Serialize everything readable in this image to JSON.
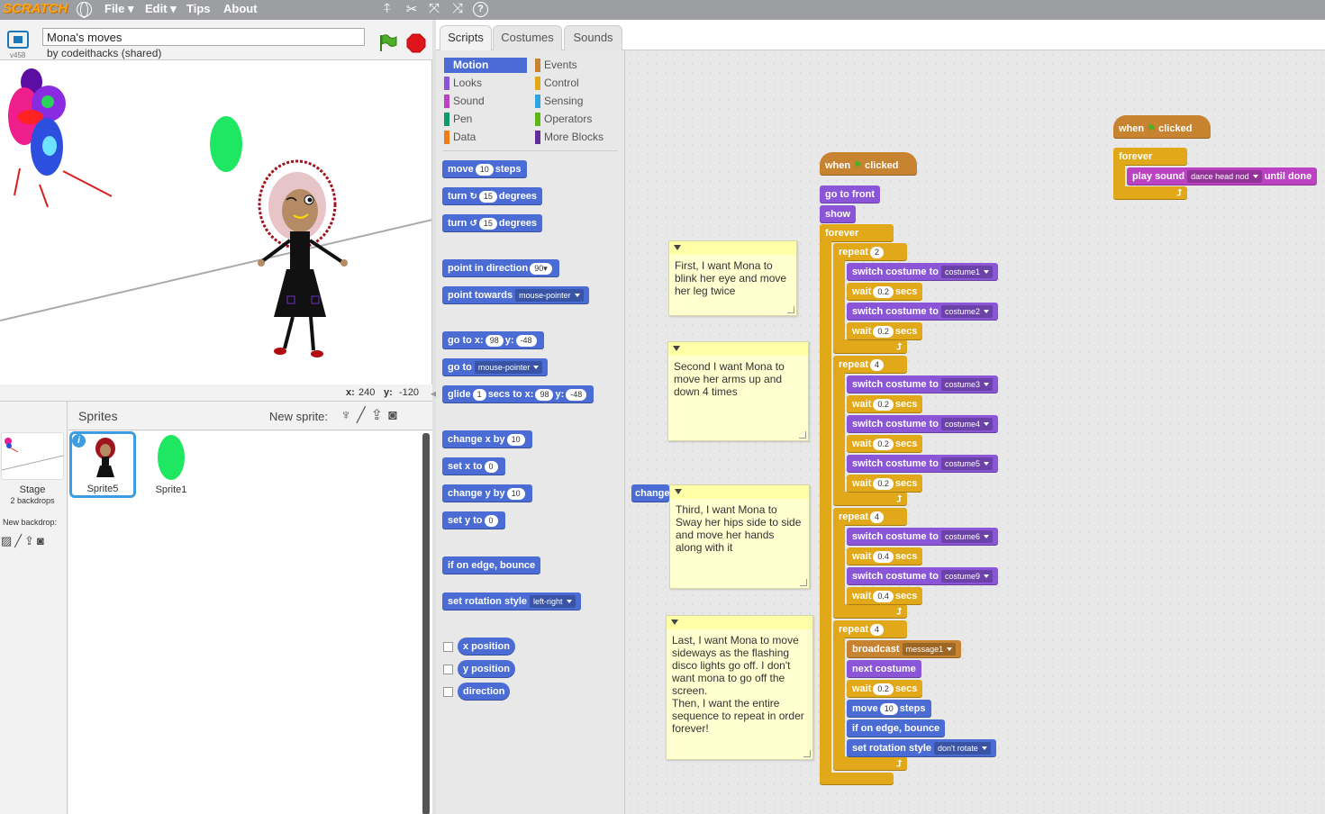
{
  "topbar": {
    "logo": "SCRATCH",
    "menus": [
      "File ▾",
      "Edit ▾",
      "Tips",
      "About"
    ],
    "tool_icons": [
      "duplicate-icon",
      "cut-icon",
      "grow-icon",
      "shrink-icon",
      "help-icon"
    ]
  },
  "stage_header": {
    "version": "v458",
    "project_title": "Mona's moves",
    "byline": "by codeithacks (shared)"
  },
  "stage": {
    "x_label": "x:",
    "x_value": "240",
    "y_label": "y:",
    "y_value": "-120"
  },
  "sprites_pane": {
    "header": "Sprites",
    "new_sprite_label": "New sprite:",
    "stage_label": "Stage",
    "stage_backdrops": "2 backdrops",
    "new_backdrop_label": "New backdrop:",
    "sprites": [
      {
        "name": "Sprite5",
        "selected": true
      },
      {
        "name": "Sprite1",
        "selected": false
      }
    ]
  },
  "tabs": [
    "Scripts",
    "Costumes",
    "Sounds"
  ],
  "categories": {
    "left": [
      {
        "label": "Motion",
        "color": "#4a6cd4"
      },
      {
        "label": "Looks",
        "color": "#8a55d7"
      },
      {
        "label": "Sound",
        "color": "#bb42c3"
      },
      {
        "label": "Pen",
        "color": "#0e9a6c"
      },
      {
        "label": "Data",
        "color": "#ee7d16"
      }
    ],
    "right": [
      {
        "label": "Events",
        "color": "#c88330"
      },
      {
        "label": "Control",
        "color": "#e1a91a"
      },
      {
        "label": "Sensing",
        "color": "#2ca5e2"
      },
      {
        "label": "Operators",
        "color": "#5cb712"
      },
      {
        "label": "More Blocks",
        "color": "#632d99"
      }
    ]
  },
  "palette": {
    "move": "move",
    "move_n": "10",
    "steps": "steps",
    "turn": "turn",
    "turn_n": "15",
    "degrees": "degrees",
    "point_in_direction": "point in direction",
    "dir_n": "90▾",
    "point_towards": "point towards",
    "mouse_pointer": "mouse-pointer",
    "go_to_x": "go to x:",
    "gx": "98",
    "y": "y:",
    "gy": "-48",
    "go_to": "go to",
    "glide": "glide",
    "glide_n": "1",
    "secs_to_x": "secs to x:",
    "change_x_by": "change x by",
    "cx": "10",
    "set_x_to": "set x to",
    "sx": "0",
    "change_y_by": "change y by",
    "cy": "10",
    "set_y_to": "set y to",
    "sy": "0",
    "if_on_edge_bounce": "if on edge, bounce",
    "set_rotation_style": "set rotation style",
    "rot_style": "left-right",
    "x_position": "x position",
    "y_position": "y position",
    "direction": "direction"
  },
  "notes": [
    "First, I want Mona to blink her eye and move her leg twice",
    "Second I want Mona to move her arms up and down 4 times",
    "Third, I want Mona to Sway her hips side to side and move her hands along with it",
    "Last, I want Mona to move sideways as the flashing disco lights go off. I don't want mona to go off the screen.\nThen, I want the entire sequence to repeat in order forever!"
  ],
  "script": {
    "when": "when",
    "clicked": "clicked",
    "go_to_front": "go to front",
    "show": "show",
    "forever": "forever",
    "repeat": "repeat",
    "switch_costume_to": "switch costume to",
    "wait": "wait",
    "secs": "secs",
    "broadcast": "broadcast",
    "message": "message1",
    "next_costume": "next costume",
    "move": "move",
    "move_n": "10",
    "steps": "steps",
    "if_on_edge_bounce": "if on edge, bounce",
    "set_rotation_style": "set rotation style",
    "rot_style": "don't rotate",
    "r1": "2",
    "r2": "4",
    "r3": "4",
    "r4": "4",
    "c1": "costume1",
    "c2": "costume2",
    "c3": "costume3",
    "c4": "costume4",
    "c5": "costume5",
    "c6": "costume6",
    "c9": "costume9",
    "w02": "0.2",
    "w04": "0.4"
  },
  "script2": {
    "when": "when",
    "clicked": "clicked",
    "forever": "forever",
    "play_sound": "play sound",
    "sound_name": "dance head nod",
    "until_done": "until done"
  },
  "stray_block": "change"
}
